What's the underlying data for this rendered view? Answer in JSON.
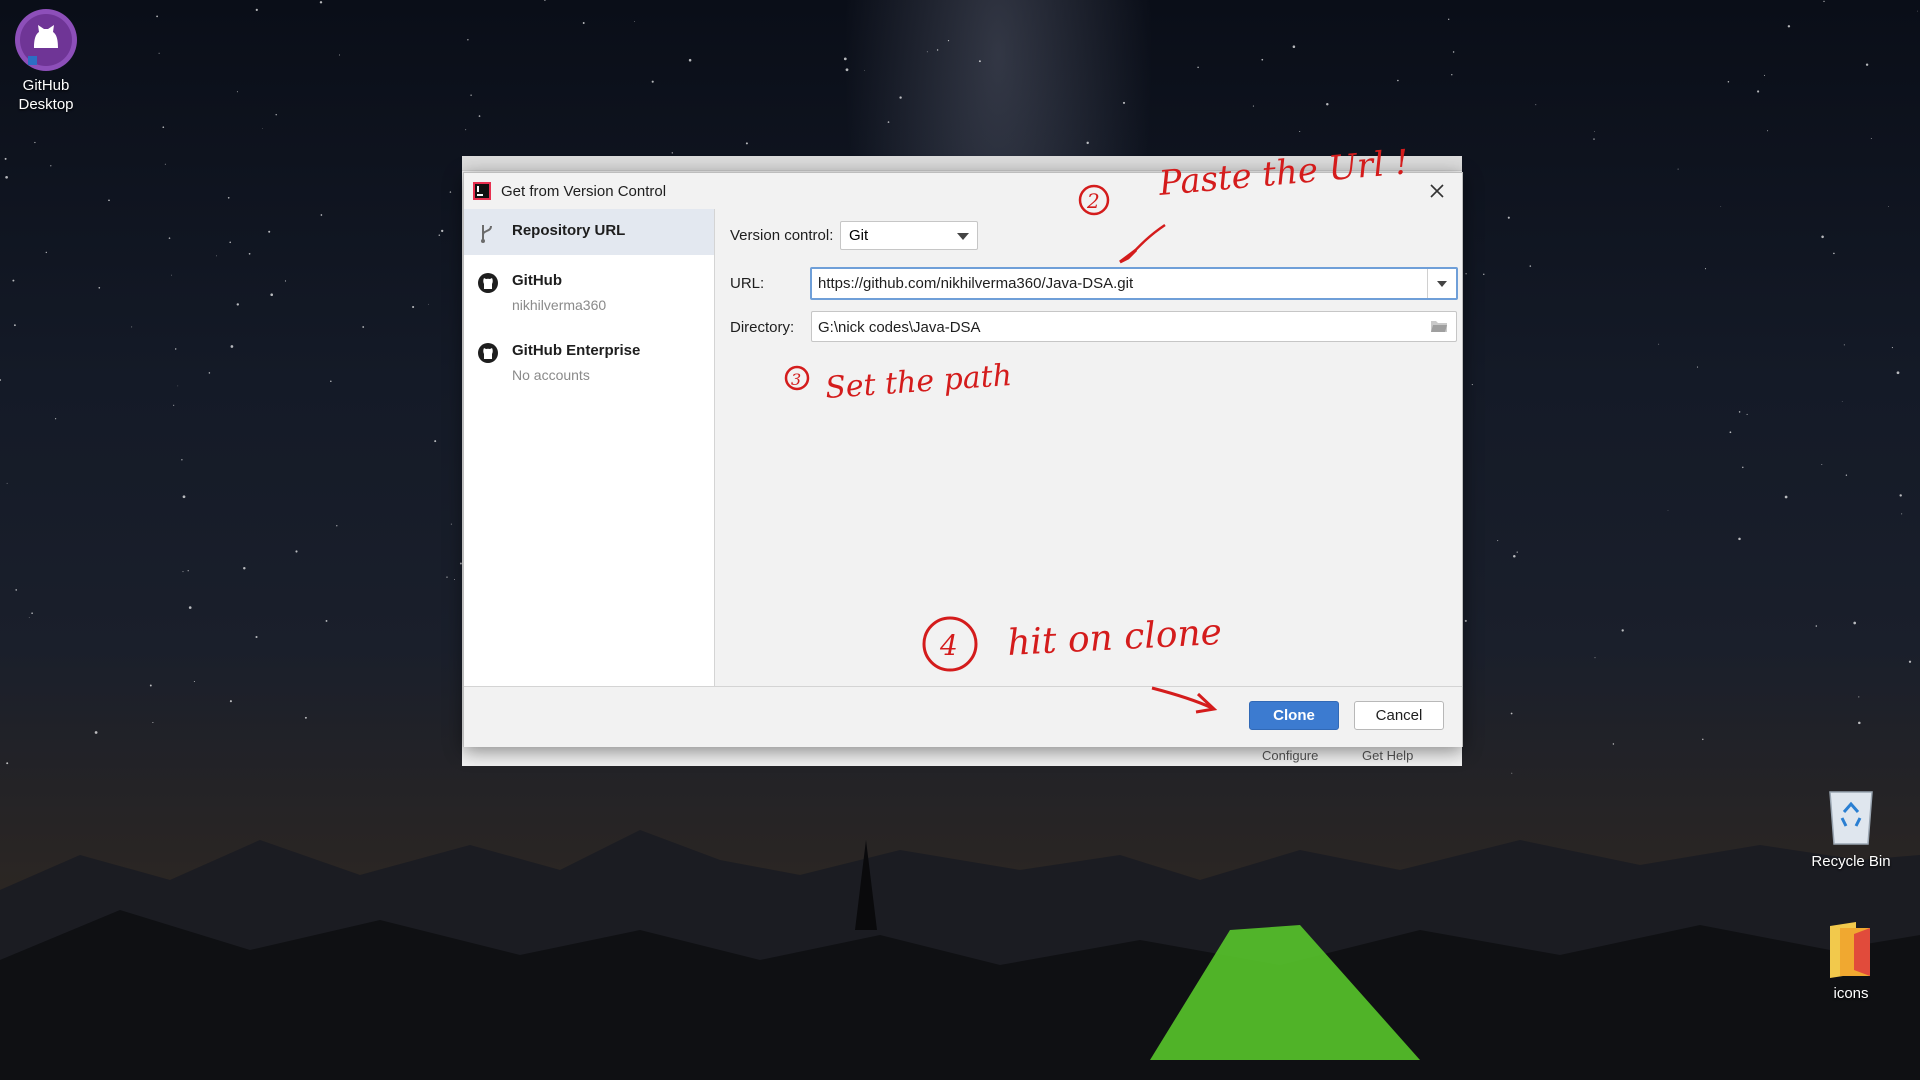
{
  "desktop": {
    "icons": [
      {
        "label_line1": "GitHub",
        "label_line2": "Desktop",
        "icon": "github-desktop-icon"
      },
      {
        "label": "Recycle Bin",
        "icon": "recycle-bin-icon"
      },
      {
        "label": "icons",
        "icon": "folder-icon"
      }
    ]
  },
  "background_window": {
    "footer_links": [
      "Configure",
      "Get Help"
    ]
  },
  "dialog": {
    "title": "Get from Version Control",
    "sidebar": [
      {
        "label": "Repository URL",
        "sub": "",
        "icon": "branch-icon",
        "selected": true
      },
      {
        "label": "GitHub",
        "sub": "nikhilverma360",
        "icon": "github-icon",
        "selected": false
      },
      {
        "label": "GitHub Enterprise",
        "sub": "No accounts",
        "icon": "github-icon",
        "selected": false
      }
    ],
    "version_control": {
      "label": "Version control:",
      "value": "Git"
    },
    "url": {
      "label": "URL:",
      "value": "https://github.com/nikhilverma360/Java-DSA.git"
    },
    "directory": {
      "label": "Directory:",
      "value": "G:\\nick codes\\Java-DSA"
    },
    "buttons": {
      "clone": "Clone",
      "cancel": "Cancel"
    }
  },
  "annotations": {
    "step2_number": "2",
    "step2_text": "Paste the Url !",
    "step3_number": "3",
    "step3_text": "Set the path",
    "step4_number": "4",
    "step4_text": "hit on clone",
    "color": "#d41c1c"
  },
  "colors": {
    "accent": "#3c7bd0",
    "focus_border": "#6f9fd8",
    "selected_row": "#e3e8f0"
  }
}
